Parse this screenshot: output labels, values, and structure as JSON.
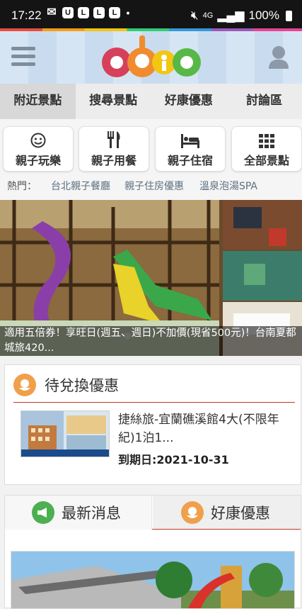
{
  "status_bar": {
    "time": "17:22",
    "network": "4G",
    "battery": "100%"
  },
  "header": {
    "logo_text": "abic"
  },
  "nav": {
    "tabs": [
      "附近景點",
      "搜尋景點",
      "好康優惠",
      "討論區"
    ]
  },
  "categories": [
    "親子玩樂",
    "親子用餐",
    "親子住宿",
    "全部景點"
  ],
  "hot": {
    "label": "熱門：",
    "links": [
      "台北親子餐廳",
      "親子住房優惠",
      "溫泉泡湯SPA"
    ]
  },
  "banner": {
    "caption": "適用五倍券！享旺日(週五、週日)不加價(現省500元)！台南夏都城旅420..."
  },
  "redeem": {
    "title": "待兌換優惠",
    "coupon_title": "捷絲旅-宜蘭礁溪館4大(不限年紀)1泊1...",
    "expiry": "到期日:2021-10-31"
  },
  "news_tabs": {
    "latest": "最新消息",
    "deals": "好康優惠"
  }
}
